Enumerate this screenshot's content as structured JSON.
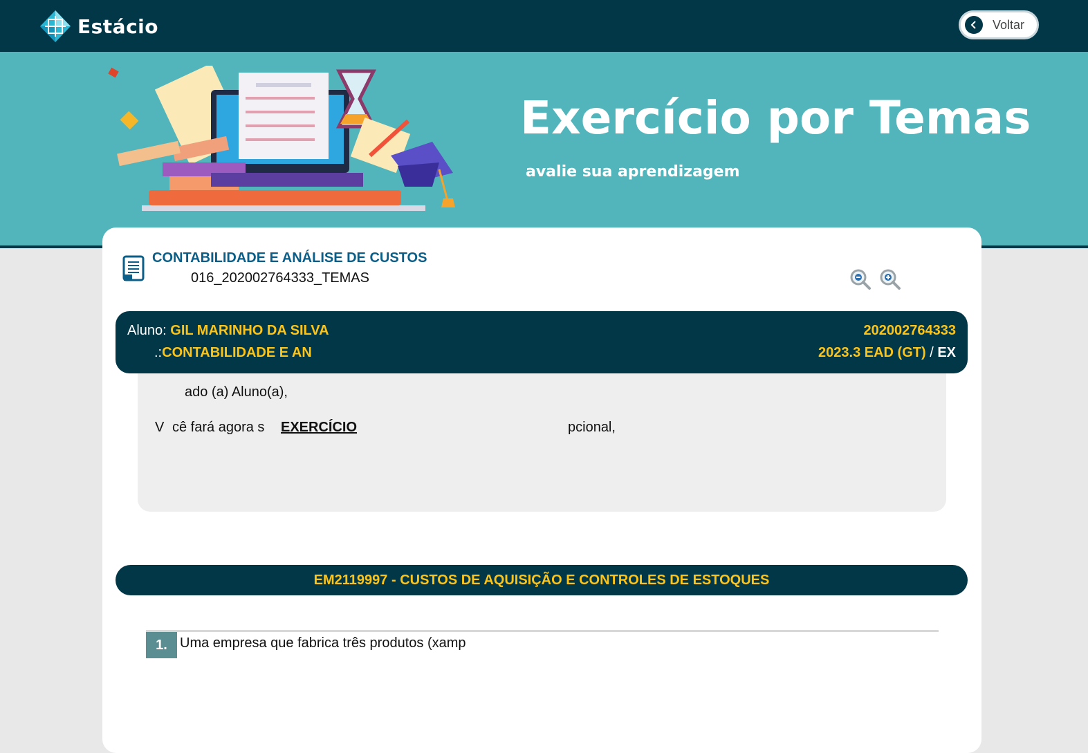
{
  "header": {
    "brand": "Estácio",
    "back_label": "Voltar"
  },
  "banner": {
    "title": "Exercício por Temas",
    "subtitle": "avalie sua aprendizagem"
  },
  "course": {
    "name": "CONTABILIDADE E ANÁLISE DE CUSTOS",
    "code": "016_202002764333_TEMAS"
  },
  "student": {
    "label": "Aluno:",
    "name": "GIL MARINHO DA SILVA",
    "course_prefix": ".:",
    "course_short": "CONTABILIDADE E AN",
    "matricula": "202002764333",
    "period": "2023.3 EAD (GT)",
    "period_sep": "/",
    "period_suffix": "EX"
  },
  "message": {
    "greeting": "ado (a) Aluno(a),",
    "line2_a": "V",
    "line2_b": "cê fará agora s",
    "line2_c": "EXERCÍCIO",
    "line2_d": "pcional,"
  },
  "topic": {
    "title": "EM2119997 - CUSTOS DE AQUISIÇÃO E CONTROLES DE ESTOQUES"
  },
  "questions": [
    {
      "number": "1.",
      "text": "Uma empresa que fabrica três produtos (xamp"
    }
  ],
  "colors": {
    "navy": "#023748",
    "teal": "#51b5bb",
    "yellow": "#fcc419",
    "course_blue": "#0b5e87"
  }
}
